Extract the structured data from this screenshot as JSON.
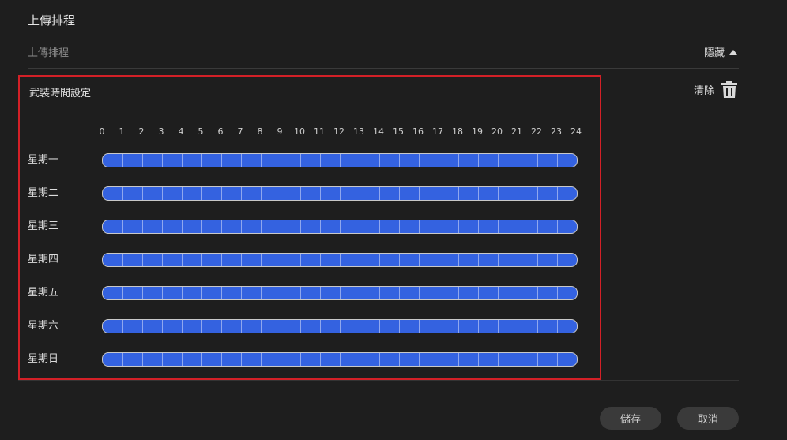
{
  "section_title": "上傳排程",
  "upload_label": "上傳排程",
  "toggle_label": "隱藏",
  "clear_label": "清除",
  "schedule": {
    "title": "武裝時間設定",
    "hours": [
      "0",
      "1",
      "2",
      "3",
      "4",
      "5",
      "6",
      "7",
      "8",
      "9",
      "10",
      "11",
      "12",
      "13",
      "14",
      "15",
      "16",
      "17",
      "18",
      "19",
      "20",
      "21",
      "22",
      "23",
      "24"
    ],
    "days": [
      "星期一",
      "星期二",
      "星期三",
      "星期四",
      "星期五",
      "星期六",
      "星期日"
    ],
    "armed_fraction": 1.0
  },
  "buttons": {
    "save": "儲存",
    "cancel": "取消"
  },
  "colors": {
    "armed": "#3462e0",
    "highlight_border": "#d32027"
  }
}
